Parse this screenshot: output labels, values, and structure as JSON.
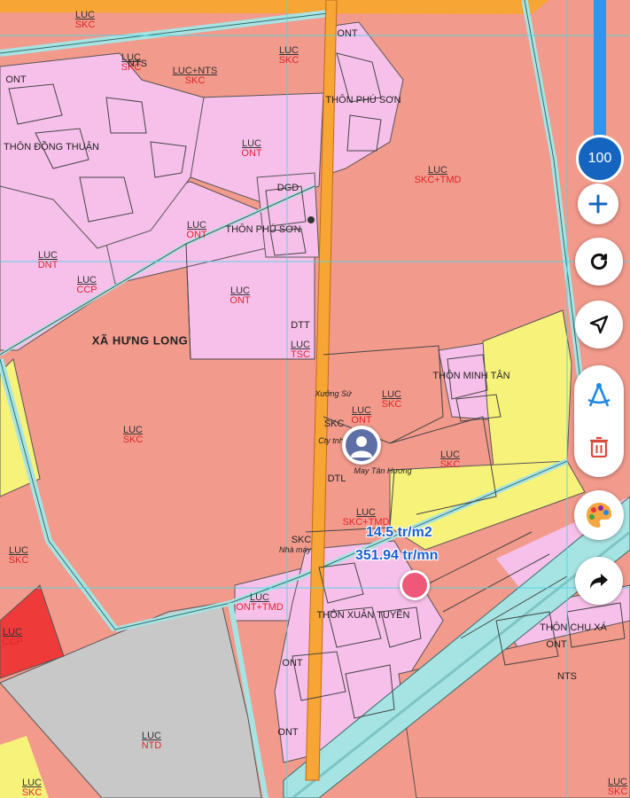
{
  "map": {
    "zoom_level": "100",
    "district_label": "XÃ HƯNG LONG",
    "village_labels": [
      {
        "text": "THÔN PHÚ SƠN"
      },
      {
        "text": "THÔN ĐỒNG THUẬN"
      },
      {
        "text": "THÔN PHÚ SƠN"
      },
      {
        "text": "THÔN MINH TÂN"
      },
      {
        "text": "THÔN XUÂN TUYỀN"
      },
      {
        "text": "THÔN CHU XÁ"
      }
    ],
    "small_labels": [
      {
        "text": "Xưởng Sứ"
      },
      {
        "text": "Cty tnhh"
      },
      {
        "text": "May Tân Hương"
      },
      {
        "text": "Nhà máy"
      }
    ],
    "parcels": [
      {
        "code": "LUC",
        "sub": "SKC"
      },
      {
        "code": "LUC",
        "sub": "SKC"
      },
      {
        "code": "LUC+NTS",
        "sub": "SKC"
      },
      {
        "code": "LUC",
        "sub": "SKC"
      },
      {
        "code": "LUC",
        "sub": "SKC+TMD"
      },
      {
        "code": "LUC",
        "sub": "ONT"
      },
      {
        "code": "LUC",
        "sub": "ONT"
      },
      {
        "code": "LUC",
        "sub": "DNT"
      },
      {
        "code": "LUC",
        "sub": "ONT"
      },
      {
        "code": "LUC",
        "sub": "TSC"
      },
      {
        "code": "LUC",
        "sub": "SKC"
      },
      {
        "code": "LUC",
        "sub": "SKC"
      },
      {
        "code": "LUC",
        "sub": "ONT"
      },
      {
        "code": "LUC",
        "sub": "SKC"
      },
      {
        "code": "LUC",
        "sub": "SKC+TMD"
      },
      {
        "code": "LUC",
        "sub": "SKC"
      },
      {
        "code": "LUC",
        "sub": "ONT+TMD"
      },
      {
        "code": "LUC",
        "sub": "CCP"
      },
      {
        "code": "LUC",
        "sub": "NTD"
      },
      {
        "code": "LUC",
        "sub": "SKC"
      },
      {
        "code": "LUC",
        "sub": "CCP"
      },
      {
        "code": "LUC",
        "sub": "SKC"
      }
    ],
    "zone_codes": [
      "ONT",
      "ONT",
      "DGD",
      "DTT",
      "SKC",
      "NTS",
      "ONT",
      "ONT",
      "SKC",
      "ONT",
      "NTS",
      "DTL"
    ],
    "price_per_m2": "14.5 tr/m2",
    "price_total": "351.94 tr/mn"
  },
  "controls": {
    "zoom_in": "plus-icon",
    "refresh": "refresh-icon",
    "locate": "navigate-icon",
    "measure": "compass-icon",
    "delete": "trash-icon",
    "palette": "palette-icon",
    "share": "share-icon"
  },
  "colors": {
    "agri_land": "#f29a8c",
    "residential": "#f7c0ea",
    "industrial_yellow": "#f7f27a",
    "water": "#a6e4e4",
    "main_road": "#f7a535",
    "accent_blue": "#1565c0",
    "pin_pink": "#f0587a"
  }
}
